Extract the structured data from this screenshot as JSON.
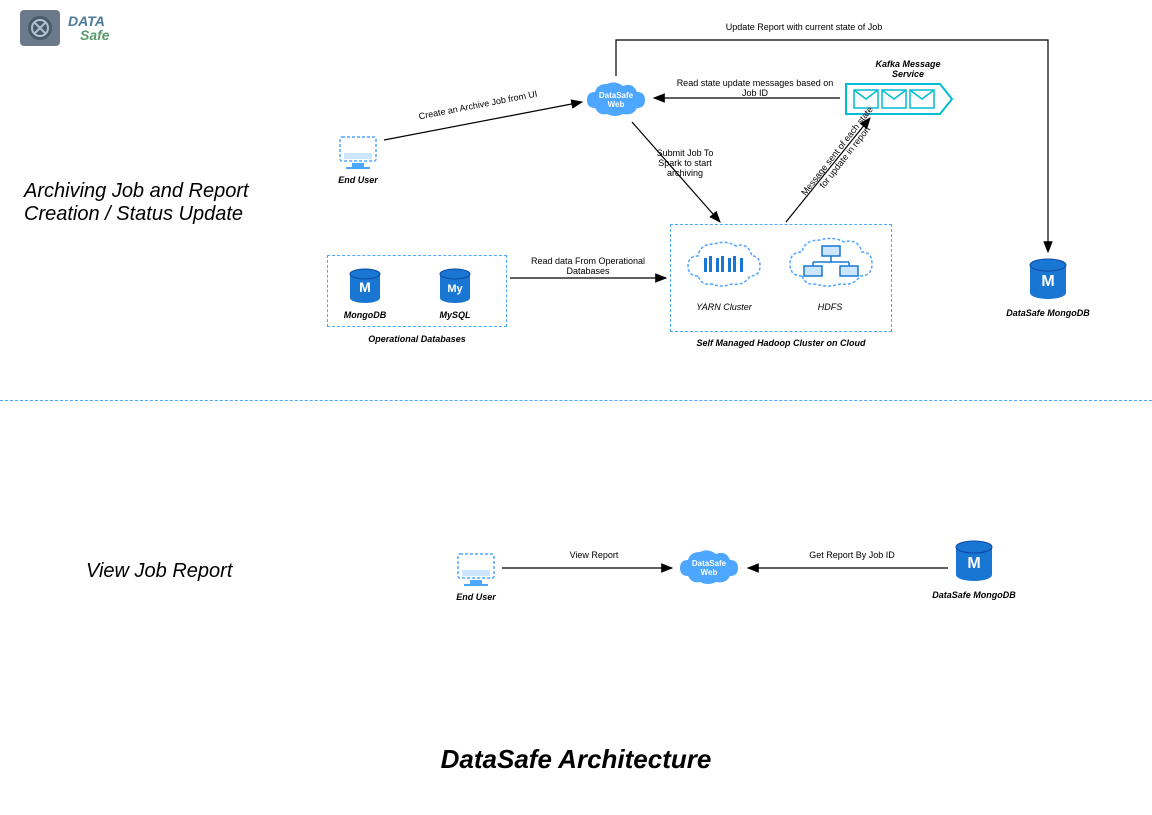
{
  "logo": {
    "brand_top": "DATA",
    "brand_bottom": "Safe"
  },
  "section1": {
    "title": "Archiving Job and Report\nCreation / Status Update"
  },
  "section2": {
    "title": "View Job Report"
  },
  "main_title": "DataSafe Architecture",
  "nodes": {
    "end_user_1": "End User",
    "end_user_2": "End User",
    "datasafe_web_1": "DataSafe\nWeb",
    "datasafe_web_2": "DataSafe\nWeb",
    "kafka": "Kafka Message\nService",
    "mongodb_op": "MongoDB",
    "mysql_op": "MySQL",
    "operational_db": "Operational Databases",
    "yarn": "YARN Cluster",
    "hdfs": "HDFS",
    "hadoop_cluster": "Self Managed Hadoop Cluster on Cloud",
    "datasafe_mongo_1": "DataSafe MongoDB",
    "datasafe_mongo_2": "DataSafe MongoDB"
  },
  "edges": {
    "create_archive": "Create an Archive Job from UI",
    "update_report": "Update Report with current state of Job",
    "read_state": "Read state update messages based on\nJob ID",
    "submit_spark": "Submit Job To\nSpark to start\narchiving",
    "message_sent": "Message sent of each state\nfor update in report",
    "read_operational": "Read data From Operational\nDatabases",
    "view_report": "View Report",
    "get_report": "Get Report By Job ID"
  }
}
